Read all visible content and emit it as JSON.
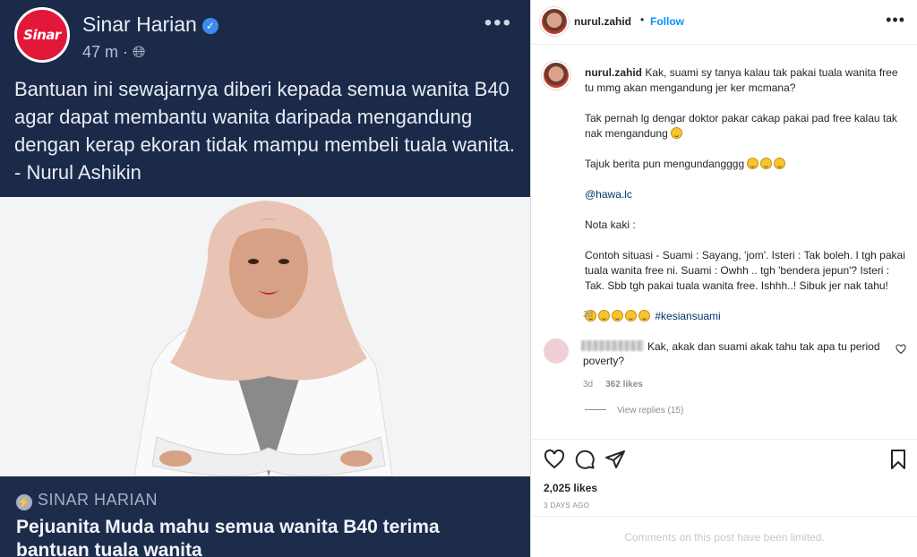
{
  "facebook_post": {
    "page_name": "Sinar Harian",
    "logo_text": "Sinar",
    "time": "47 m · ",
    "more": "•••",
    "body": "Bantuan ini sewajarnya diberi kepada semua wanita B40 agar dapat membantu wanita daripada mengandung dengan kerap ekoran tidak mampu membeli tuala wanita. - Nurul Ashikin",
    "source": "SINAR HARIAN",
    "headline": "Pejuanita Muda mahu semua wanita B40 terima bantuan tuala wanita"
  },
  "instagram": {
    "username": "nurul.zahid",
    "separator": "•",
    "follow": "Follow",
    "more": "•••",
    "caption": {
      "username": "nurul.zahid",
      "p1": "Kak, suami sy tanya kalau tak pakai tuala wanita free tu mmg akan mengandung jer ker mcmana?",
      "p2": "Tak pernah lg dengar doktor pakar cakap pakai pad free kalau tak nak mengandung",
      "p3": "Tajuk berita pun mengundangggg",
      "mention": "@hawa.lc",
      "p4": "Nota kaki :",
      "p5": "Contoh situasi - Suami : Sayang, 'jom'. Isteri : Tak boleh. I tgh pakai tuala wanita free ni. Suami : Owhh .. tgh 'bendera jepun'? Isteri : Tak. Sbb tgh pakai tuala wanita free. Ishhh..! Sibuk jer nak tahu!",
      "hashtag": "#kesiansuami"
    },
    "post_age": "3d",
    "comment": {
      "text": "Kak, akak dan suami akak tahu tak apa tu period poverty?",
      "age": "3d",
      "likes": "362 likes",
      "view_replies": "View replies (15)"
    },
    "likes": "2,025 likes",
    "date": "3 DAYS AGO",
    "comments_limited": "Comments on this post have been limited.",
    "icons": [
      "heart-icon",
      "comment-icon",
      "share-icon",
      "bookmark-icon"
    ]
  }
}
